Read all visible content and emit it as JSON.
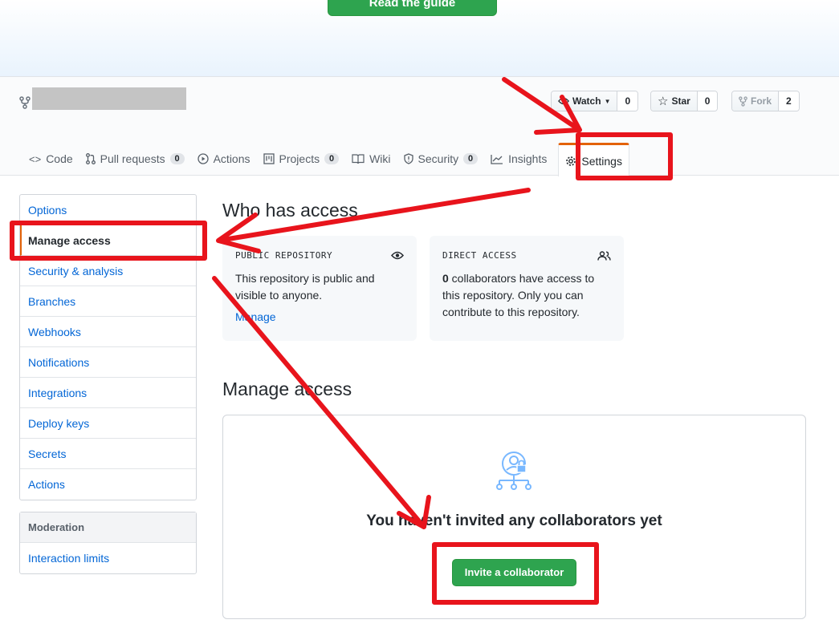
{
  "banner": {
    "guide_button": "Read the guide"
  },
  "repo": {
    "watch": {
      "label": "Watch",
      "count": "0"
    },
    "star": {
      "label": "Star",
      "count": "0"
    },
    "fork": {
      "label": "Fork",
      "count": "2"
    }
  },
  "tabs": [
    {
      "label": "Code",
      "icon": "code-icon"
    },
    {
      "label": "Pull requests",
      "icon": "pull-request-icon",
      "counter": "0"
    },
    {
      "label": "Actions",
      "icon": "play-icon"
    },
    {
      "label": "Projects",
      "icon": "project-icon",
      "counter": "0"
    },
    {
      "label": "Wiki",
      "icon": "book-icon"
    },
    {
      "label": "Security",
      "icon": "shield-icon",
      "counter": "0"
    },
    {
      "label": "Insights",
      "icon": "graph-icon"
    },
    {
      "label": "Settings",
      "icon": "gear-icon",
      "selected": true
    }
  ],
  "sidebar": {
    "items": [
      "Options",
      "Manage access",
      "Security & analysis",
      "Branches",
      "Webhooks",
      "Notifications",
      "Integrations",
      "Deploy keys",
      "Secrets",
      "Actions"
    ],
    "active": "Manage access",
    "moderation": {
      "header": "Moderation",
      "items": [
        "Interaction limits"
      ]
    }
  },
  "who_has_access": {
    "title": "Who has access",
    "public": {
      "caption": "PUBLIC REPOSITORY",
      "line1": "This repository is public and",
      "line2": "visible to anyone.",
      "link": "Manage"
    },
    "direct": {
      "caption": "DIRECT ACCESS",
      "count": "0",
      "line1": " collaborators have access to",
      "line2": "this repository. Only you can",
      "line3": "contribute to this repository."
    }
  },
  "manage_access": {
    "title": "Manage access",
    "blank_title": "You haven't invited any collaborators yet",
    "invite_button": "Invite a collaborator"
  },
  "colors": {
    "primary_green": "#2ea44f",
    "link_blue": "#0366d6",
    "tab_accent": "#e36209",
    "annotation_red": "#e8141c"
  }
}
